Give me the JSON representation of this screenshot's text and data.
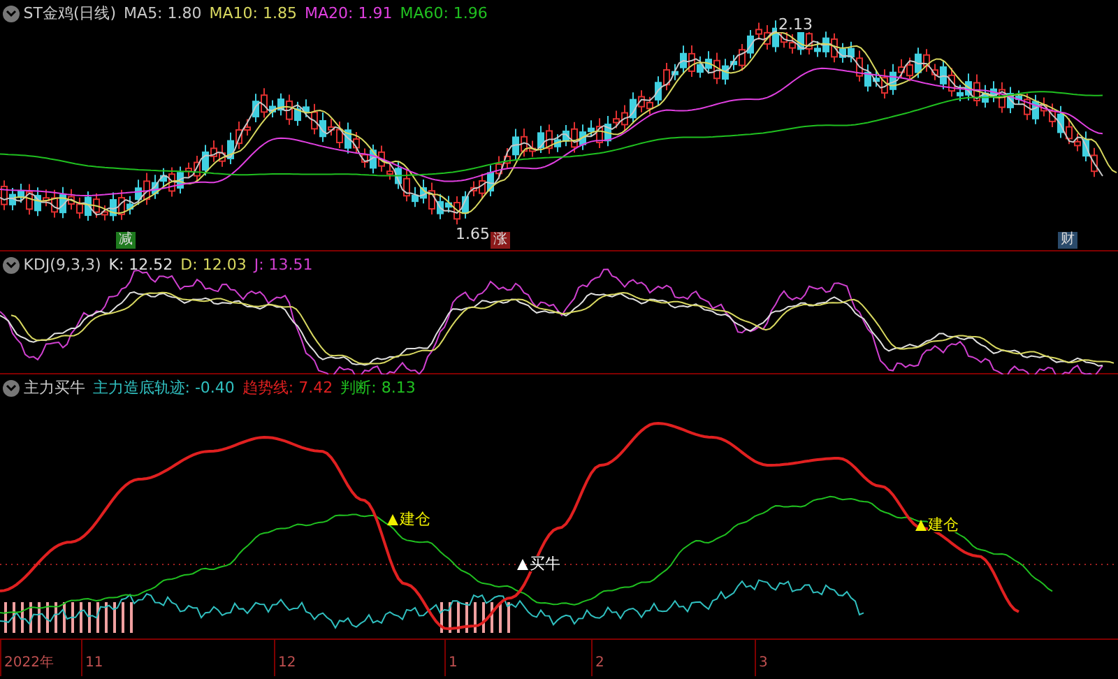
{
  "main_panel": {
    "title": "ST金鸡(日线)",
    "indicators": [
      {
        "label": "MA5: 1.80",
        "color": "#c8c8c8"
      },
      {
        "label": "MA10: 1.85",
        "color": "#d8d860"
      },
      {
        "label": "MA20: 1.91",
        "color": "#e040e0"
      },
      {
        "label": "MA60: 1.96",
        "color": "#20c020"
      }
    ],
    "high_label": "2.13",
    "low_label": "1.65",
    "event_tags": [
      {
        "text": "减",
        "color": "#1e7a1e"
      },
      {
        "text": "涨",
        "color": "#8b1a1a"
      },
      {
        "text": "财",
        "color": "#2a4a6a"
      }
    ]
  },
  "kdj_panel": {
    "title": "KDJ(9,3,3)",
    "indicators": [
      {
        "label": "K: 12.52",
        "color": "#e0e0e0"
      },
      {
        "label": "D: 12.03",
        "color": "#d8d860"
      },
      {
        "label": "J: 13.51",
        "color": "#d040d0"
      }
    ]
  },
  "signal_panel": {
    "title": "主力买牛",
    "indicators": [
      {
        "label": "主力造底轨迹: -0.40",
        "color": "#30c0c0"
      },
      {
        "label": "趋势线: 7.42",
        "color": "#e02020"
      },
      {
        "label": "判断: 8.13",
        "color": "#20c020"
      }
    ],
    "signals": [
      {
        "text": "建仓",
        "color": "#f0f000"
      },
      {
        "text": "买牛",
        "color": "#ffffff"
      },
      {
        "text": "建仓",
        "color": "#f0f000"
      }
    ]
  },
  "time_axis": [
    "2022年",
    "11",
    "12",
    "1",
    "2",
    "3"
  ]
}
